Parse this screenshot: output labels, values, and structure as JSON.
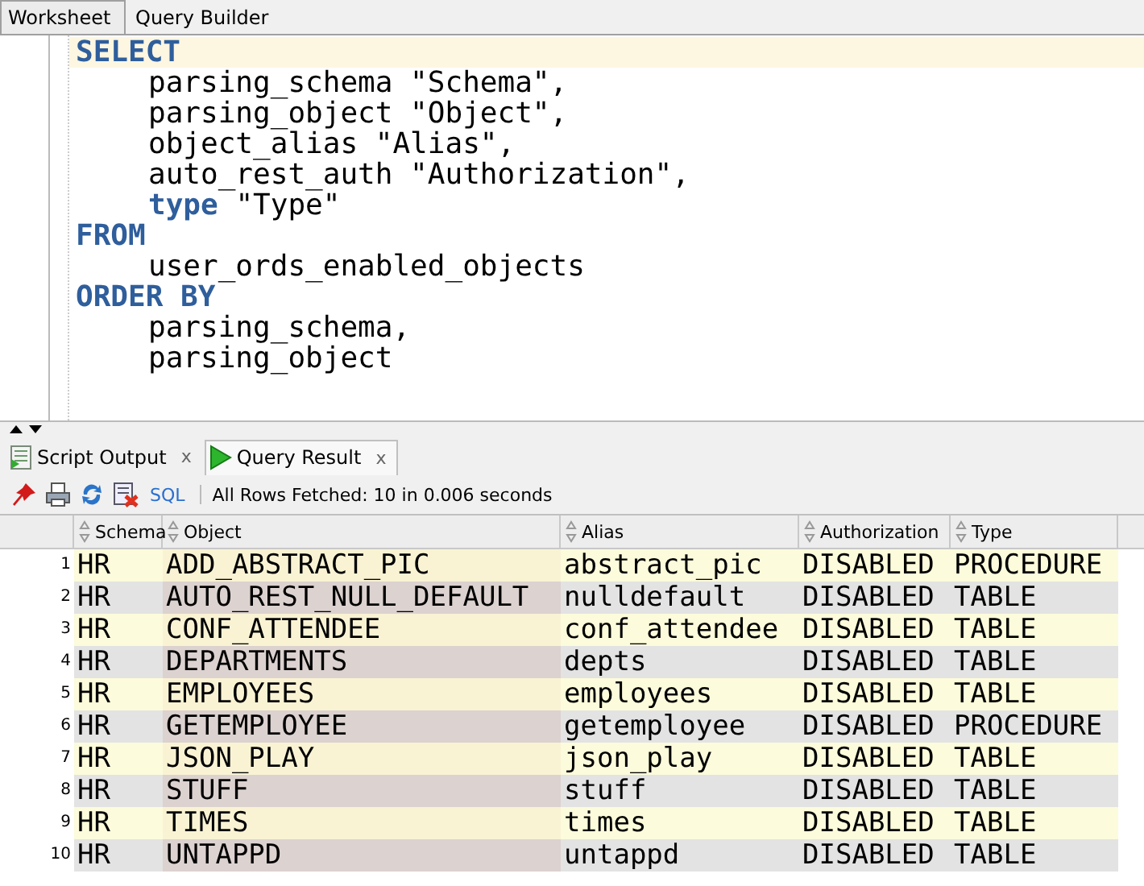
{
  "editor_tabs": [
    {
      "label": "Worksheet",
      "selected": true
    },
    {
      "label": "Query Builder",
      "selected": false
    }
  ],
  "editor": {
    "lines": [
      {
        "current": true,
        "indent": false,
        "tokens": [
          {
            "kind": "keyword",
            "text": "SELECT"
          }
        ]
      },
      {
        "current": false,
        "indent": true,
        "tokens": [
          {
            "kind": "plain",
            "text": "parsing_schema \"Schema\","
          }
        ]
      },
      {
        "current": false,
        "indent": true,
        "tokens": [
          {
            "kind": "plain",
            "text": "parsing_object \"Object\","
          }
        ]
      },
      {
        "current": false,
        "indent": true,
        "tokens": [
          {
            "kind": "plain",
            "text": "object_alias \"Alias\","
          }
        ]
      },
      {
        "current": false,
        "indent": true,
        "tokens": [
          {
            "kind": "plain",
            "text": "auto_rest_auth \"Authorization\","
          }
        ]
      },
      {
        "current": false,
        "indent": true,
        "tokens": [
          {
            "kind": "keyword",
            "text": "type"
          },
          {
            "kind": "plain",
            "text": " \"Type\""
          }
        ]
      },
      {
        "current": false,
        "indent": false,
        "tokens": [
          {
            "kind": "keyword",
            "text": "FROM"
          }
        ]
      },
      {
        "current": false,
        "indent": true,
        "tokens": [
          {
            "kind": "plain",
            "text": "user_ords_enabled_objects"
          }
        ]
      },
      {
        "current": false,
        "indent": false,
        "tokens": [
          {
            "kind": "keyword",
            "text": "ORDER BY"
          }
        ]
      },
      {
        "current": false,
        "indent": true,
        "tokens": [
          {
            "kind": "plain",
            "text": "parsing_schema,"
          }
        ]
      },
      {
        "current": false,
        "indent": true,
        "tokens": [
          {
            "kind": "plain",
            "text": "parsing_object"
          }
        ]
      }
    ]
  },
  "output_tabs": [
    {
      "label": "Script Output",
      "close": "x",
      "selected": false
    },
    {
      "label": "Query Result",
      "close": "x",
      "selected": true
    }
  ],
  "toolbar": {
    "sql_link": "SQL",
    "status": "All Rows Fetched: 10 in 0.006 seconds"
  },
  "table": {
    "columns": [
      "Schema",
      "Object",
      "Alias",
      "Authorization",
      "Type"
    ],
    "rows": [
      {
        "number": "1",
        "cells": [
          "HR",
          "ADD_ABSTRACT_PIC",
          "abstract_pic",
          "DISABLED",
          "PROCEDURE"
        ]
      },
      {
        "number": "2",
        "cells": [
          "HR",
          "AUTO_REST_NULL_DEFAULT",
          "nulldefault",
          "DISABLED",
          "TABLE"
        ]
      },
      {
        "number": "3",
        "cells": [
          "HR",
          "CONF_ATTENDEE",
          "conf_attendee",
          "DISABLED",
          "TABLE"
        ]
      },
      {
        "number": "4",
        "cells": [
          "HR",
          "DEPARTMENTS",
          "depts",
          "DISABLED",
          "TABLE"
        ]
      },
      {
        "number": "5",
        "cells": [
          "HR",
          "EMPLOYEES",
          "employees",
          "DISABLED",
          "TABLE"
        ]
      },
      {
        "number": "6",
        "cells": [
          "HR",
          "GETEMPLOYEE",
          "getemployee",
          "DISABLED",
          "PROCEDURE"
        ]
      },
      {
        "number": "7",
        "cells": [
          "HR",
          "JSON_PLAY",
          "json_play",
          "DISABLED",
          "TABLE"
        ]
      },
      {
        "number": "8",
        "cells": [
          "HR",
          "STUFF",
          "stuff",
          "DISABLED",
          "TABLE"
        ]
      },
      {
        "number": "9",
        "cells": [
          "HR",
          "TIMES",
          "times",
          "DISABLED",
          "TABLE"
        ]
      },
      {
        "number": "10",
        "cells": [
          "HR",
          "UNTAPPD",
          "untappd",
          "DISABLED",
          "TABLE"
        ]
      }
    ]
  }
}
